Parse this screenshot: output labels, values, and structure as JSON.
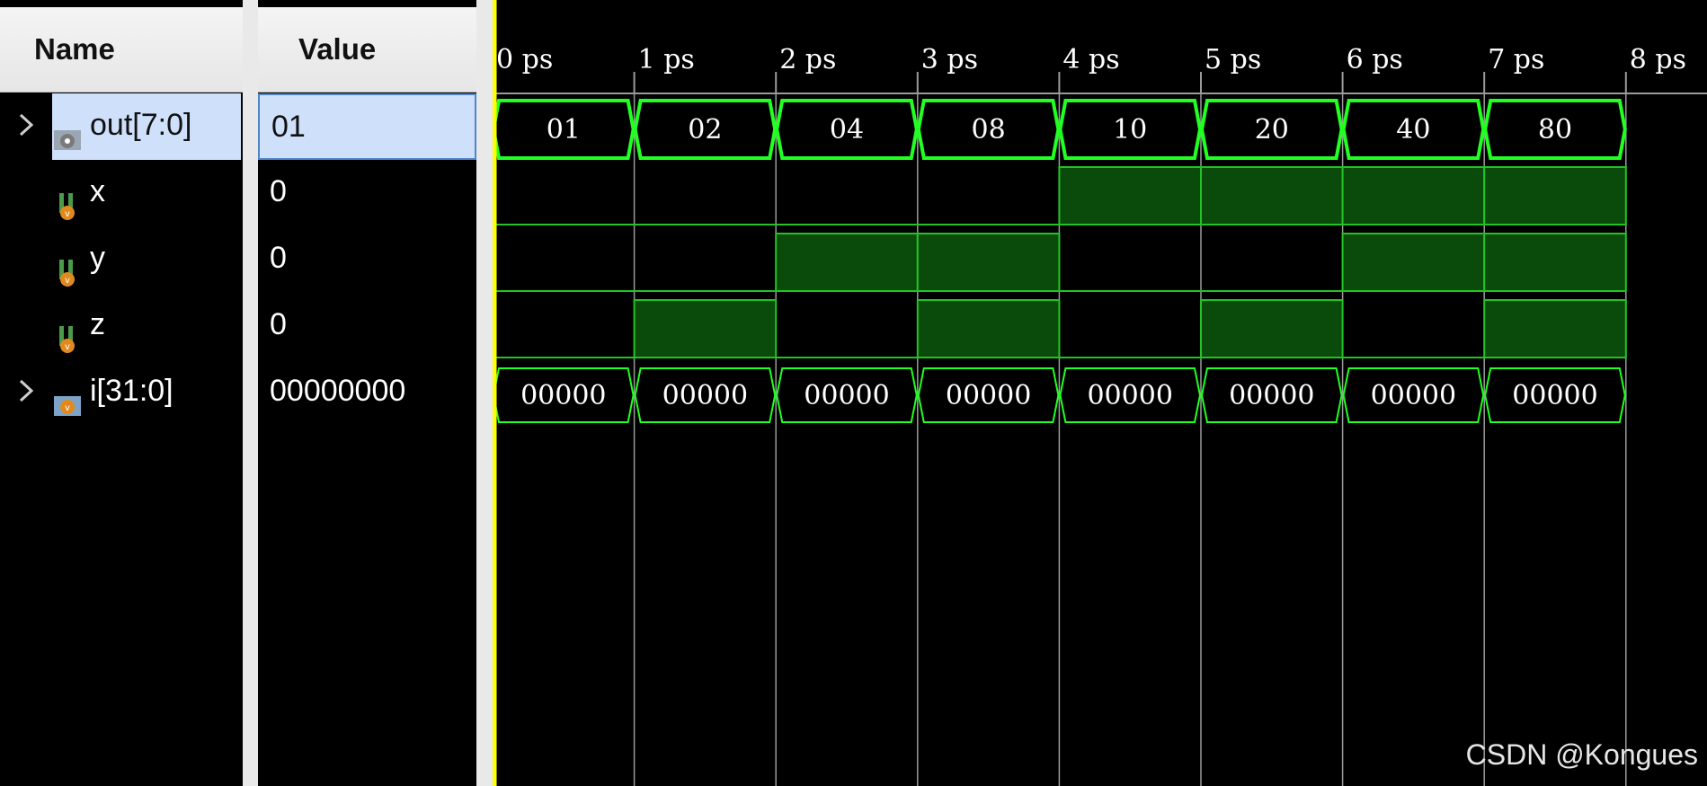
{
  "columns": {
    "name_header": "Name",
    "value_header": "Value"
  },
  "signals": [
    {
      "name": "out[7:0]",
      "value": "01",
      "kind": "bus",
      "expandable": true,
      "selected": true
    },
    {
      "name": "x",
      "value": "0",
      "kind": "bit",
      "expandable": false
    },
    {
      "name": "y",
      "value": "0",
      "kind": "bit",
      "expandable": false
    },
    {
      "name": "z",
      "value": "0",
      "kind": "bit",
      "expandable": false
    },
    {
      "name": "i[31:0]",
      "value": "00000000",
      "kind": "bus",
      "expandable": true
    }
  ],
  "timeline": {
    "unit": "ps",
    "ticks": [
      "0 ps",
      "1 ps",
      "2 ps",
      "3 ps",
      "4 ps",
      "5 ps",
      "6 ps",
      "7 ps",
      "8 ps"
    ],
    "cursor_time": 0
  },
  "waveforms": {
    "out": [
      "01",
      "02",
      "04",
      "08",
      "10",
      "20",
      "40",
      "80"
    ],
    "x": [
      0,
      0,
      0,
      0,
      1,
      1,
      1,
      1
    ],
    "y": [
      0,
      0,
      1,
      1,
      0,
      0,
      1,
      1
    ],
    "z": [
      0,
      1,
      0,
      1,
      0,
      1,
      0,
      1
    ],
    "i": [
      "00000",
      "00000",
      "00000",
      "00000",
      "00000",
      "00000",
      "00000",
      "00000"
    ]
  },
  "colors": {
    "wave_green": "#22ff22",
    "high_fill": "#0a4a0a",
    "low_line": "#22c322",
    "cursor": "#ffff00",
    "grid": "#9a9a9a",
    "selection": "#cfe0fb"
  },
  "icons": {
    "bus": "bus-signal-icon",
    "bit": "bit-signal-icon",
    "expand": "chevron-right-icon"
  },
  "watermark": "CSDN @Kongues"
}
